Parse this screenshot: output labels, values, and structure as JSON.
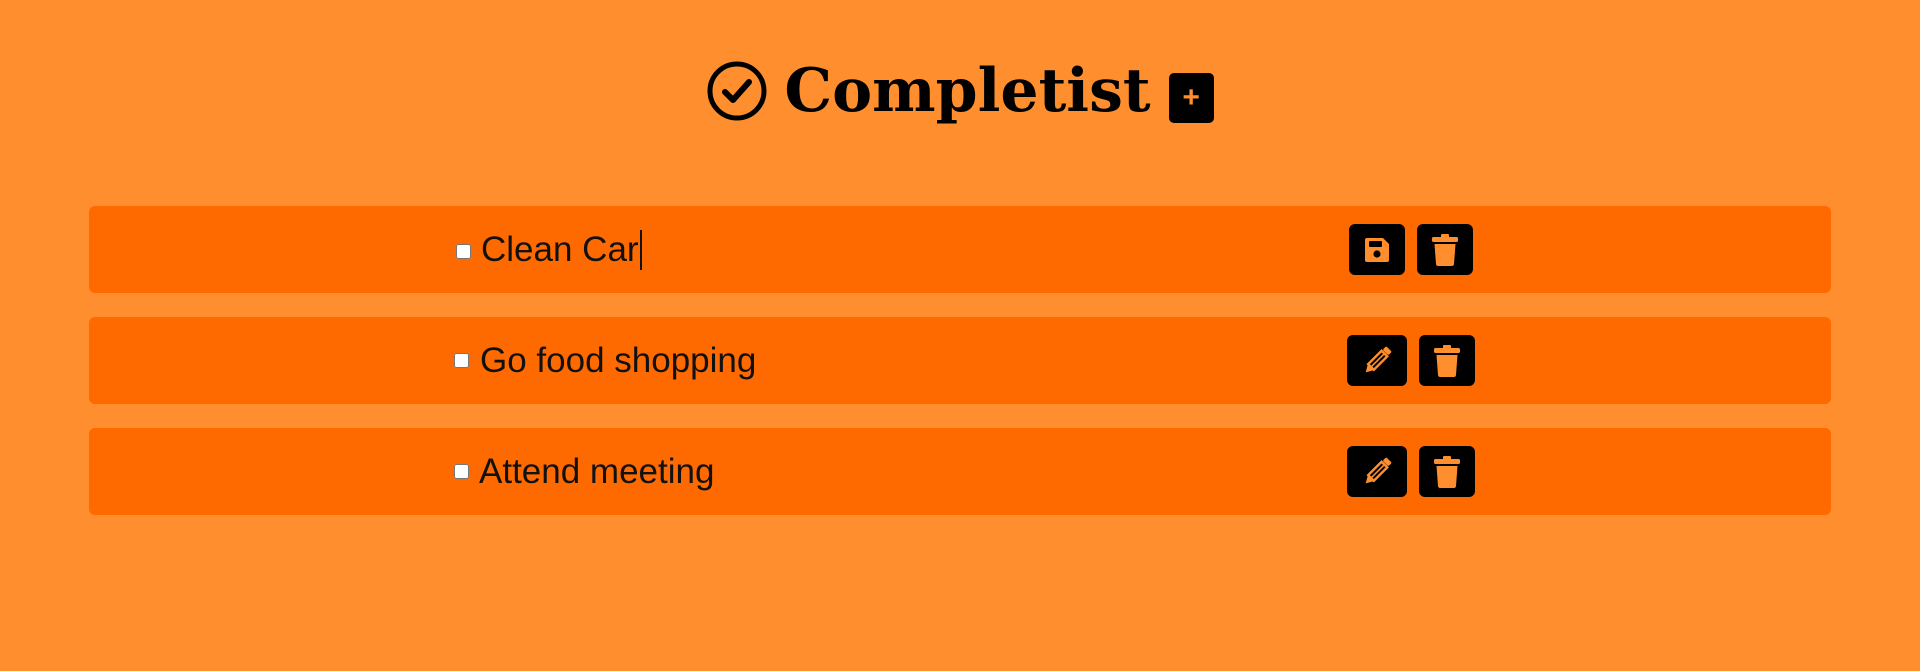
{
  "app": {
    "title": "Completist",
    "add_button_label": "+",
    "logo_icon": "check-circle-icon"
  },
  "colors": {
    "background": "#ff8f2e",
    "row_background": "#ff6a00",
    "button_background": "#000000",
    "icon_color": "#ff8f2e"
  },
  "tasks": [
    {
      "text": "Clean Car",
      "checked": false,
      "editing": true,
      "primary_action": "save-icon",
      "secondary_action": "trash-icon"
    },
    {
      "text": "Go food shopping",
      "checked": false,
      "editing": false,
      "primary_action": "pencil-icon",
      "secondary_action": "trash-icon"
    },
    {
      "text": "Attend meeting",
      "checked": false,
      "editing": false,
      "primary_action": "pencil-icon",
      "secondary_action": "trash-icon"
    }
  ]
}
